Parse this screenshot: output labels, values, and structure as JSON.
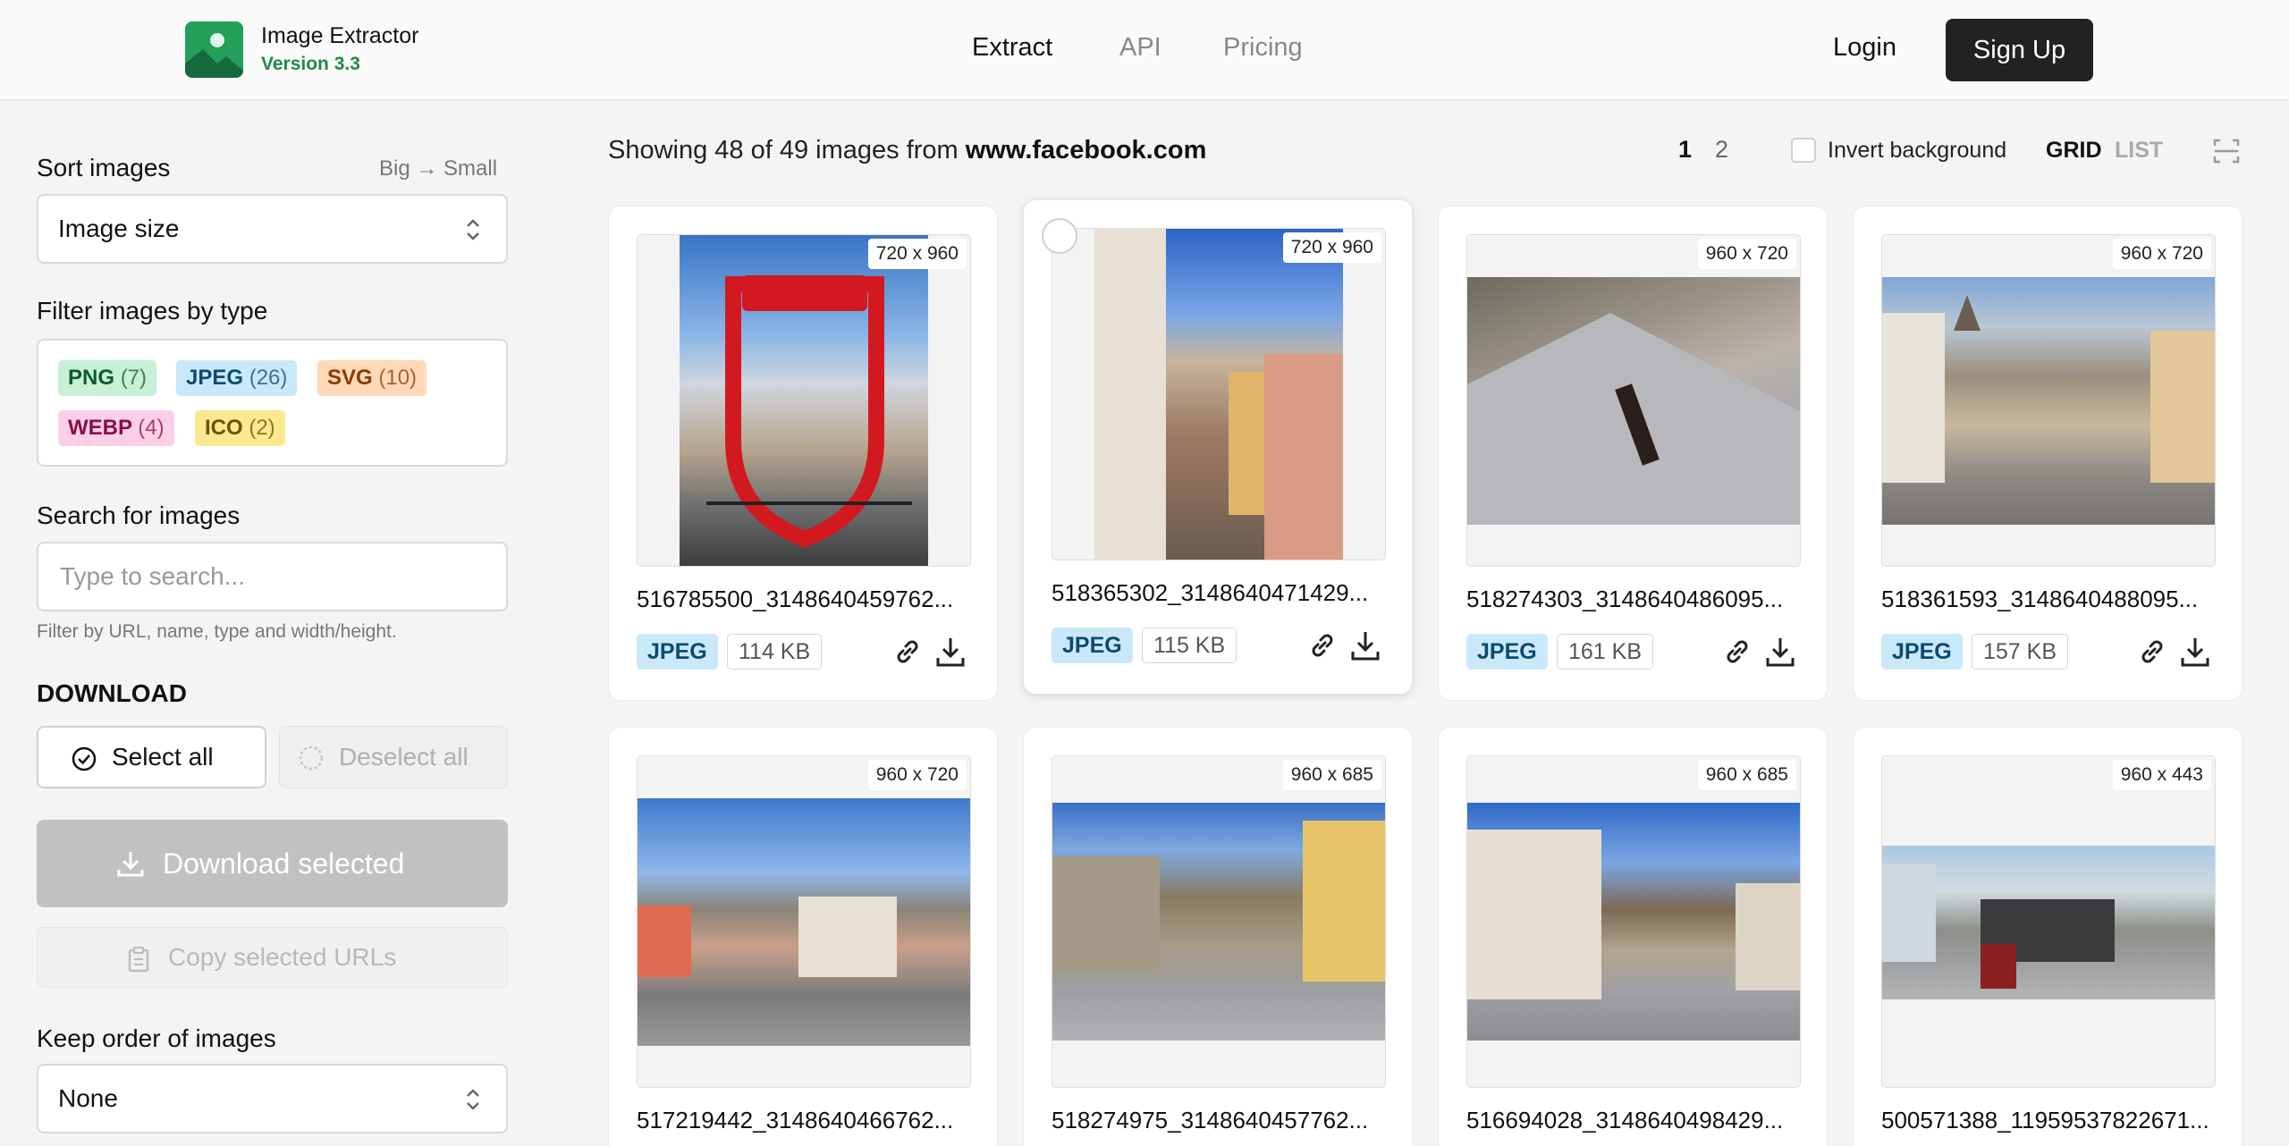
{
  "header": {
    "app_name": "Image Extractor",
    "version": "Version 3.3",
    "nav": [
      "Extract",
      "API",
      "Pricing"
    ],
    "login_label": "Login",
    "signup_label": "Sign Up"
  },
  "sidebar": {
    "sort_label": "Sort images",
    "sort_hint": "Big → Small",
    "sort_value": "Image size",
    "filter_label": "Filter images by type",
    "types": [
      {
        "name": "PNG",
        "count": "(7)"
      },
      {
        "name": "JPEG",
        "count": "(26)"
      },
      {
        "name": "SVG",
        "count": "(10)"
      },
      {
        "name": "WEBP",
        "count": "(4)"
      },
      {
        "name": "ICO",
        "count": "(2)"
      }
    ],
    "search_label": "Search for images",
    "search_placeholder": "Type to search...",
    "search_help": "Filter by URL, name, type and width/height.",
    "download_title": "DOWNLOAD",
    "select_all": "Select all",
    "deselect_all": "Deselect all",
    "download_selected": "Download selected",
    "copy_urls": "Copy selected URLs",
    "order_label": "Keep order of images",
    "order_value": "None"
  },
  "toolbar": {
    "showing_text": "Showing 48 of 49 images from",
    "domain": "www.facebook.com",
    "pages": [
      "1",
      "2"
    ],
    "invert_label": "Invert background",
    "view_grid": "GRID",
    "view_list": "LIST"
  },
  "cards": [
    {
      "dims_w": "720",
      "dims_h": "960",
      "name": "516785500_3148640459762...",
      "type": "JPEG",
      "size": "114 KB"
    },
    {
      "dims_w": "720",
      "dims_h": "960",
      "name": "518365302_3148640471429...",
      "type": "JPEG",
      "size": "115 KB"
    },
    {
      "dims_w": "960",
      "dims_h": "720",
      "name": "518274303_3148640486095...",
      "type": "JPEG",
      "size": "161 KB"
    },
    {
      "dims_w": "960",
      "dims_h": "720",
      "name": "518361593_3148640488095...",
      "type": "JPEG",
      "size": "157 KB"
    },
    {
      "dims_w": "960",
      "dims_h": "720",
      "name": "517219442_3148640466762..."
    },
    {
      "dims_w": "960",
      "dims_h": "685",
      "name": "518274975_3148640457762..."
    },
    {
      "dims_w": "960",
      "dims_h": "685",
      "name": "516694028_3148640498429..."
    },
    {
      "dims_w": "960",
      "dims_h": "443",
      "name": "500571388_11959537822671..."
    }
  ],
  "colors": {
    "brand_green": "#22a05a",
    "signup_bg": "#222222",
    "jpeg_tag": "#c9e9fb"
  }
}
